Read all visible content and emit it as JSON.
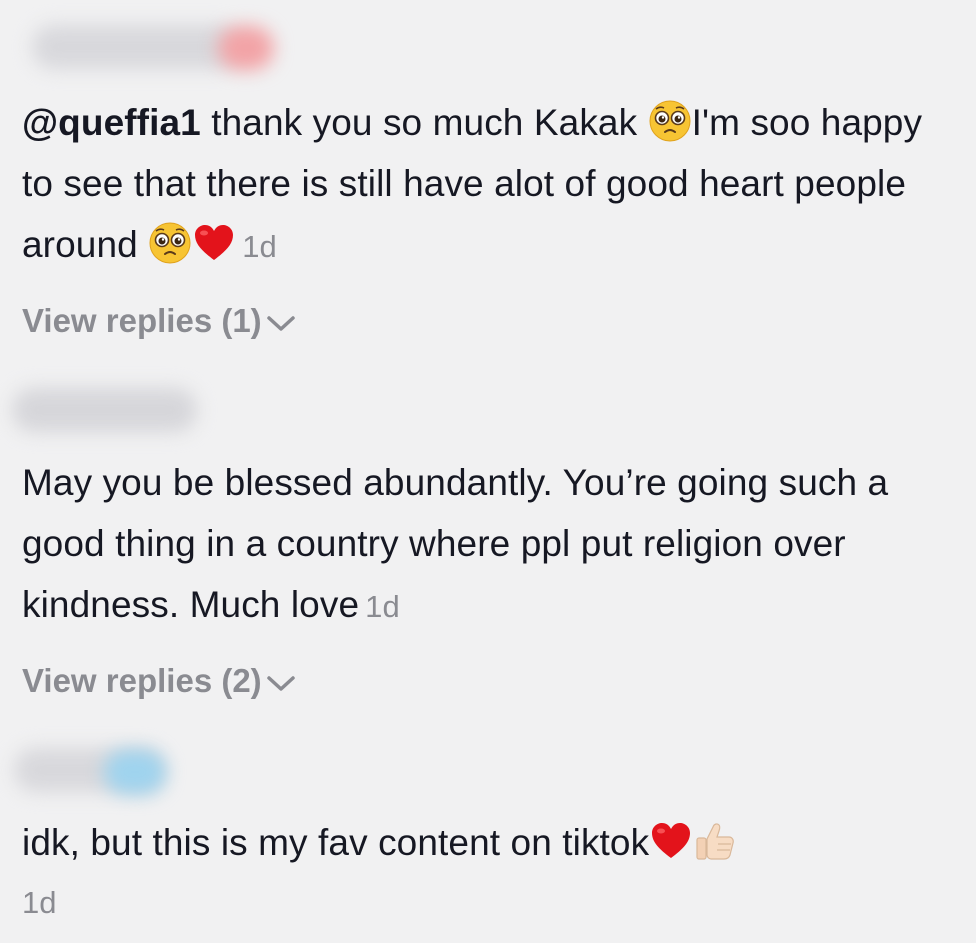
{
  "comments": [
    {
      "mention": "@queffia1",
      "text_part1": " thank you so much Kakak ",
      "text_part2": "I'm soo happy to see that there is still have alot of good heart people around ",
      "time": "1d",
      "view_replies": "View replies (1)",
      "name_blur_color": "#d8d8dc",
      "name_blur_accent": "#f2a3a6"
    },
    {
      "text": "May you be blessed abundantly. You’re going such a good thing in a country where ppl put religion over kindness. Much love",
      "time": "1d",
      "view_replies": "View replies (2)",
      "name_blur_color": "#d6d6da"
    },
    {
      "text": "idk, but this is my fav content on tiktok",
      "time": "1d",
      "name_blur_color": "#d8d8dc",
      "name_blur_accent": "#9fd3ee"
    }
  ],
  "icons": [
    "pleading-face-icon",
    "red-heart-icon",
    "thumbs-up-icon",
    "chevron-down-icon"
  ]
}
